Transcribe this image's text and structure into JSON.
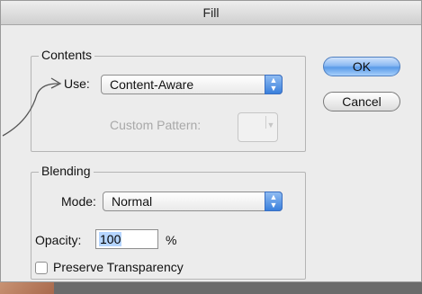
{
  "window": {
    "title": "Fill"
  },
  "contents": {
    "legend": "Contents",
    "use_label": "Use:",
    "use_value": "Content-Aware",
    "custom_pattern_label": "Custom Pattern:"
  },
  "buttons": {
    "ok": "OK",
    "cancel": "Cancel"
  },
  "blending": {
    "legend": "Blending",
    "mode_label": "Mode:",
    "mode_value": "Normal",
    "opacity_label": "Opacity:",
    "opacity_value": "100",
    "opacity_unit": "%",
    "preserve_label": "Preserve Transparency",
    "preserve_checked": false
  },
  "icons": {
    "popup_arrows": "up-down-arrows-icon",
    "annotation": "curved-arrow-icon"
  },
  "colors": {
    "default_button": "#5a9ae8",
    "selection": "#b5d5ff"
  }
}
